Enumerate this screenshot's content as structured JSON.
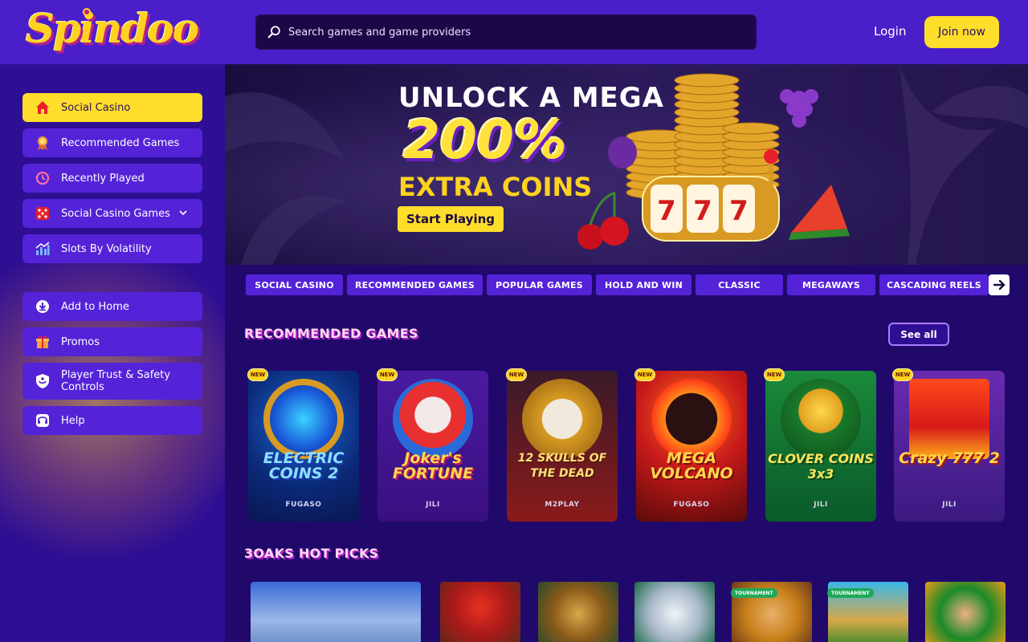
{
  "header": {
    "logo_text": "Spindoo",
    "search_placeholder": "Search games and game providers",
    "login_label": "Login",
    "join_label": "Join now"
  },
  "sidebar": {
    "items": [
      {
        "label": "Social Casino",
        "icon": "house-icon"
      },
      {
        "label": "Recommended Games",
        "icon": "award-ribbon-icon"
      },
      {
        "label": "Recently Played",
        "icon": "history-clock-icon"
      },
      {
        "label": "Social Casino Games",
        "icon": "dice-icon"
      },
      {
        "label": "Slots By Volatility",
        "icon": "bar-chart-icon"
      }
    ],
    "extra_items": [
      {
        "label": "Add to Home",
        "icon": "download-icon"
      },
      {
        "label": "Promos",
        "icon": "gift-icon"
      },
      {
        "label": "Player Trust & Safety Controls",
        "icon": "shield-hand-icon"
      },
      {
        "label": "Help",
        "icon": "headset-icon"
      }
    ]
  },
  "banner": {
    "line1": "UNLOCK A MEGA",
    "line2": "200%",
    "line3": "EXTRA COINS",
    "cta": "Start Playing",
    "slot_reels": "777"
  },
  "categories": [
    "SOCIAL CASINO",
    "RECOMMENDED GAMES",
    "POPULAR GAMES",
    "HOLD AND WIN",
    "CLASSIC",
    "MEGAWAYS",
    "CASCADING REELS"
  ],
  "recommended": {
    "title": "RECOMMENDED GAMES",
    "see_all": "See all",
    "badge": "NEW",
    "games": [
      {
        "name": "ELECTRIC COINS 2",
        "provider": "FUGASO"
      },
      {
        "name": "Joker's FORTUNE",
        "provider": "JILI"
      },
      {
        "name": "12 SKULLS OF THE DEAD",
        "provider": "M2PLAY"
      },
      {
        "name": "MEGA VOLCANO",
        "provider": "FUGASO"
      },
      {
        "name": "CLOVER COINS 3x3",
        "provider": "JILI"
      },
      {
        "name": "Crazy 777 2",
        "provider": "JILI"
      }
    ]
  },
  "hot_picks": {
    "title": "3OAKS HOT PICKS",
    "tournament_label": "TOURNAMENT"
  },
  "colors": {
    "header": "#4a1fc9",
    "sidebar": "#2e0f93",
    "main": "#21096b",
    "accent_yellow": "#ffdd2b",
    "nav_item": "#5423d8"
  }
}
